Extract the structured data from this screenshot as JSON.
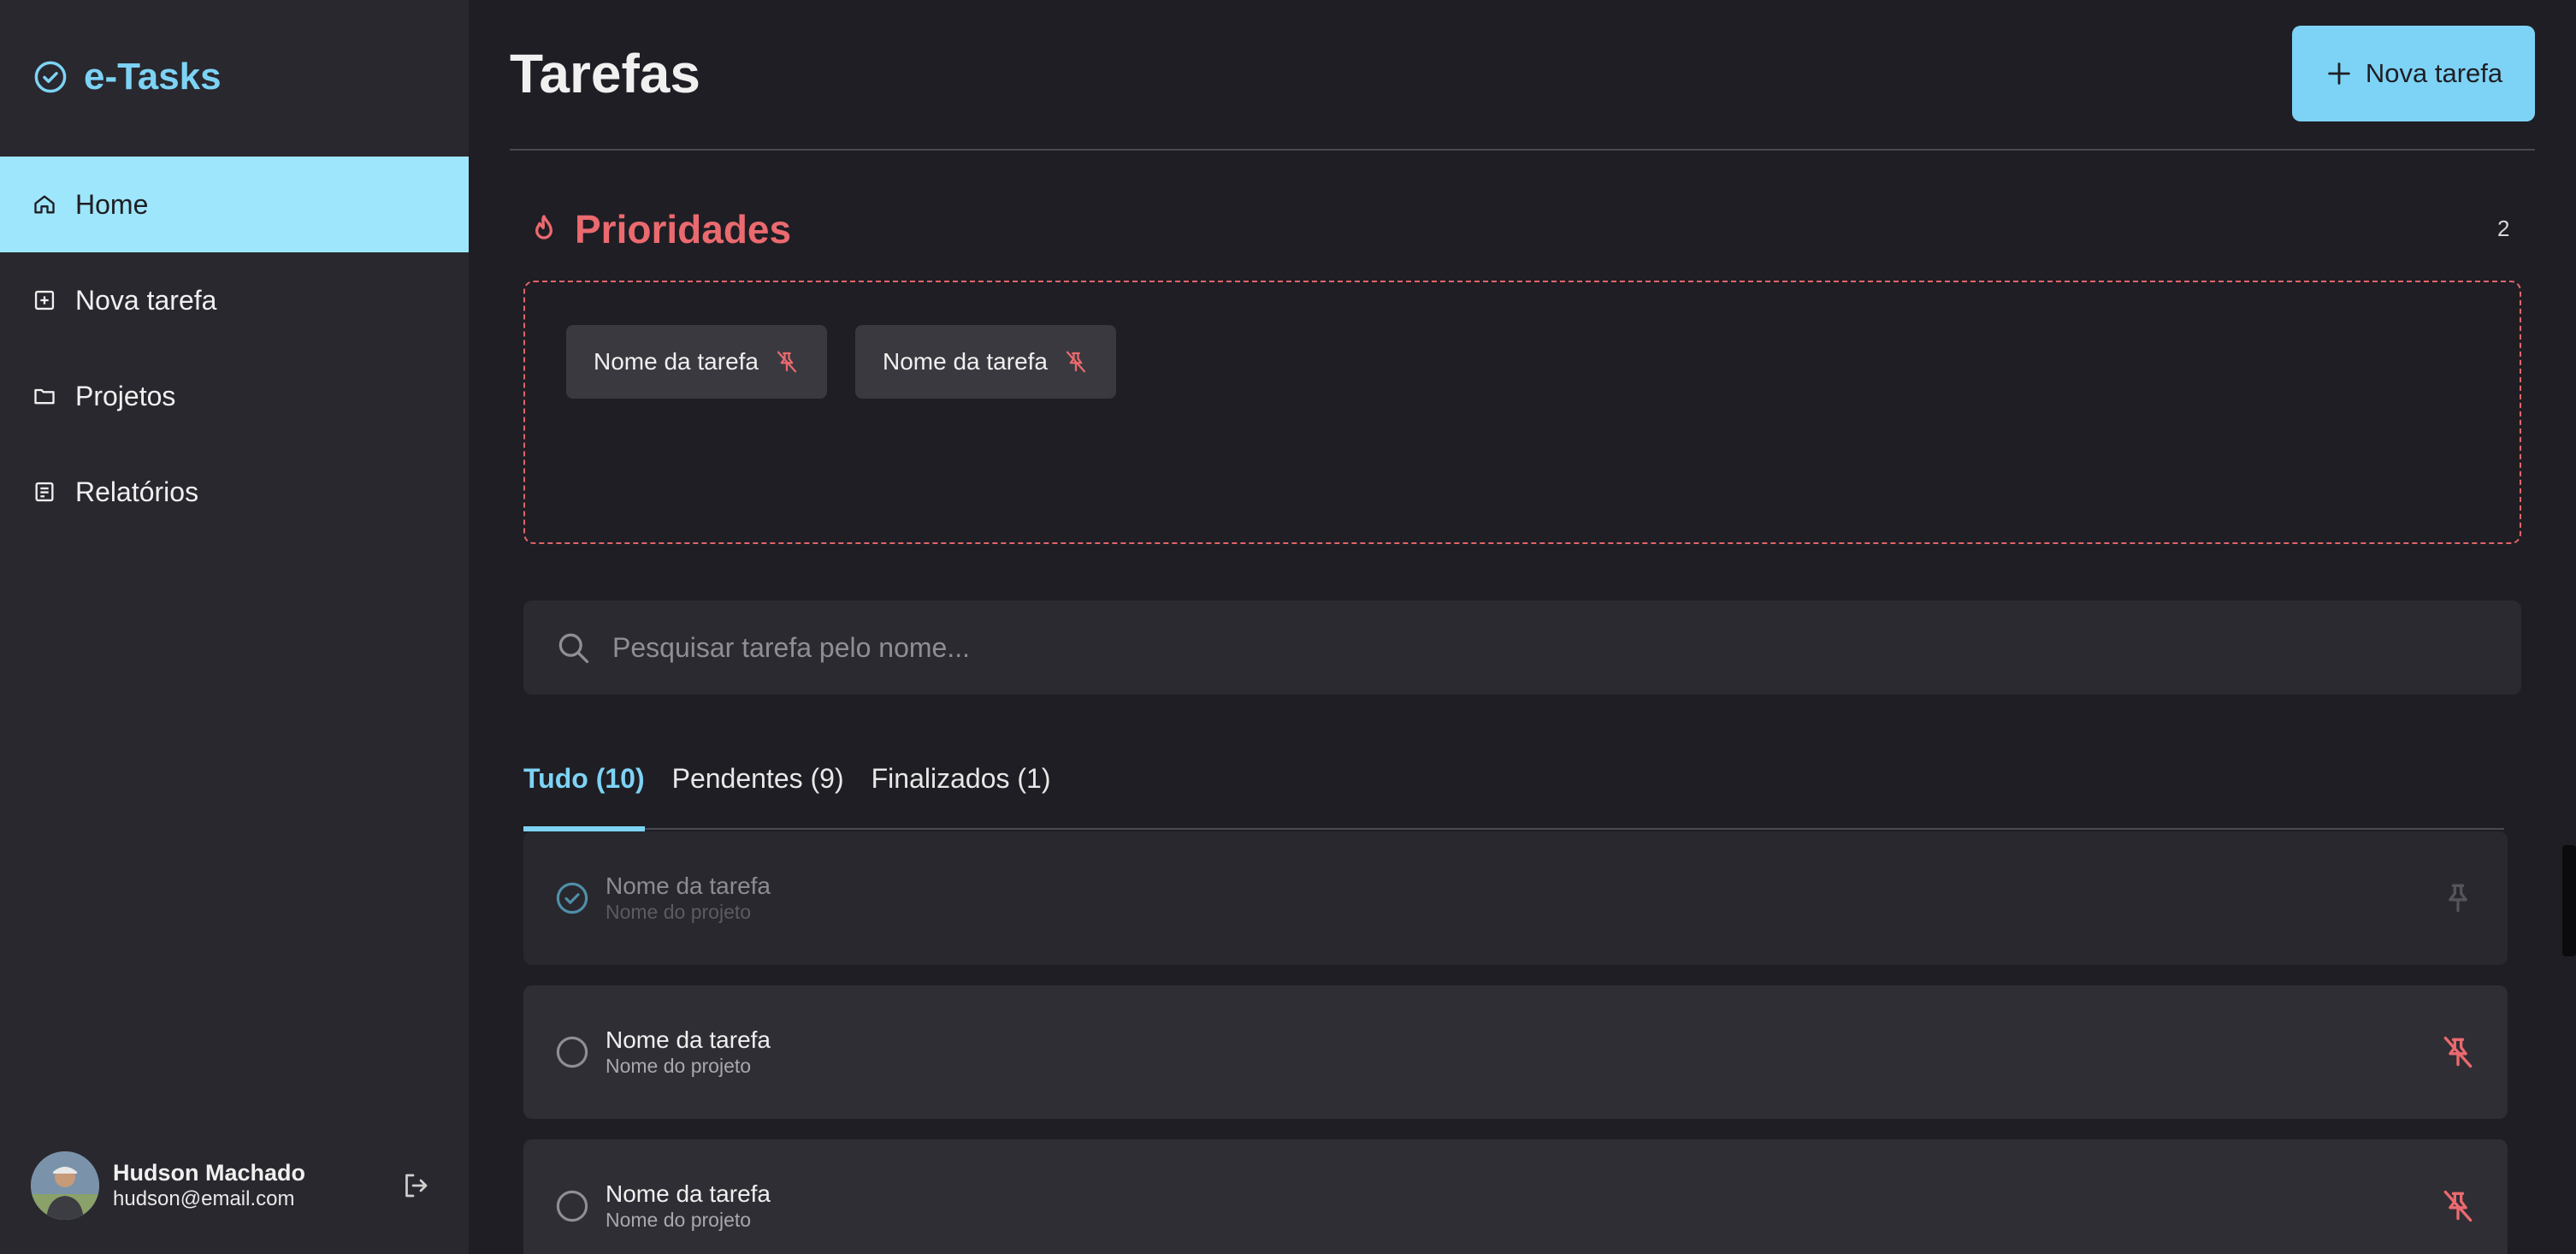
{
  "app": {
    "name": "e-Tasks"
  },
  "sidebar": {
    "items": [
      {
        "label": "Home",
        "icon": "home-icon",
        "active": true
      },
      {
        "label": "Nova tarefa",
        "icon": "square-plus-icon",
        "active": false
      },
      {
        "label": "Projetos",
        "icon": "folder-icon",
        "active": false
      },
      {
        "label": "Relatórios",
        "icon": "report-icon",
        "active": false
      }
    ]
  },
  "user": {
    "name": "Hudson Machado",
    "email": "hudson@email.com"
  },
  "header": {
    "title": "Tarefas",
    "new_task_label": "Nova tarefa"
  },
  "priorities": {
    "title": "Prioridades",
    "count": "2",
    "chips": [
      {
        "label": "Nome da tarefa"
      },
      {
        "label": "Nome da tarefa"
      }
    ]
  },
  "search": {
    "placeholder": "Pesquisar tarefa pelo nome..."
  },
  "tabs": [
    {
      "label": "Tudo (10)",
      "active": true
    },
    {
      "label": "Pendentes (9)",
      "active": false
    },
    {
      "label": "Finalizados (1)",
      "active": false
    }
  ],
  "tasks": [
    {
      "name": "Nome da tarefa",
      "project": "Nome do projeto",
      "done": true,
      "pinned": false
    },
    {
      "name": "Nome da tarefa",
      "project": "Nome do projeto",
      "done": false,
      "pinned": true
    },
    {
      "name": "Nome da tarefa",
      "project": "Nome do projeto",
      "done": false,
      "pinned": true
    }
  ],
  "colors": {
    "accent": "#7dd3f5",
    "active_nav_bg": "#9ee6fb",
    "priority_red": "#ea6a6f",
    "background": "#1f1e24",
    "sidebar_bg": "#29282e"
  }
}
